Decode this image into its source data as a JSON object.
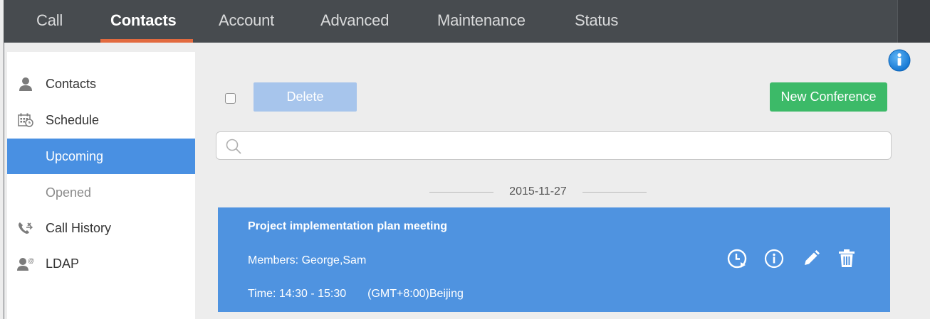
{
  "nav": {
    "tabs": [
      {
        "label": "Call"
      },
      {
        "label": "Contacts"
      },
      {
        "label": "Account"
      },
      {
        "label": "Advanced"
      },
      {
        "label": "Maintenance"
      },
      {
        "label": "Status"
      }
    ],
    "active_tab": "Contacts"
  },
  "sidebar": {
    "items": [
      {
        "label": "Contacts",
        "icon": "person-icon"
      },
      {
        "label": "Schedule",
        "icon": "calendar-icon"
      },
      {
        "label": "Upcoming"
      },
      {
        "label": "Opened"
      },
      {
        "label": "Call History",
        "icon": "phone-history-icon"
      },
      {
        "label": "LDAP",
        "icon": "ldap-icon"
      }
    ],
    "active_item": "Upcoming"
  },
  "toolbar": {
    "delete_label": "Delete",
    "new_conference_label": "New Conference"
  },
  "search": {
    "placeholder": "",
    "value": ""
  },
  "schedule": {
    "date": "2015-11-27",
    "meeting": {
      "title": "Project implementation plan meeting",
      "members": "Members:  George,Sam",
      "time": "Time: 14:30 - 15:30",
      "timezone": "(GMT+8:00)Beijing"
    }
  },
  "colors": {
    "nav_bg": "#474b4f",
    "nav_accent": "#e26a3f",
    "active_blue": "#4990e2",
    "card_blue": "#4f93e0",
    "delete_disabled": "#a7c5ec",
    "new_conference_green": "#3cba68",
    "info_blue": "#1e90e6"
  }
}
